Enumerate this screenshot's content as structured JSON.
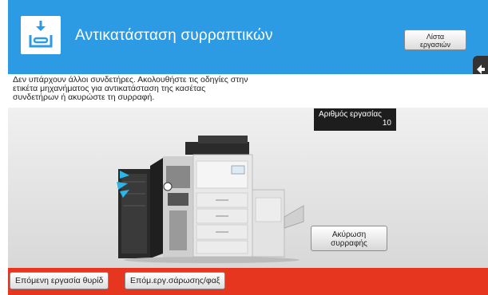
{
  "header": {
    "title": "Αντικατάσταση συρραπτικών",
    "icon": "staple-cartridge-icon",
    "job_list_line1": "Λίστα",
    "job_list_line2": "εργασιών",
    "side_tab_icon": "arrow-left-icon"
  },
  "message": {
    "line1": "Δεν υπάρχουν άλλοι συνδετήρες. Ακολουθήστε τις οδηγίες στην",
    "line2": "ετικέτα μηχανήματος για αντικατάσταση της κασέτας",
    "line3": "συνδετήρων ή ακυρώστε τη συρραφή."
  },
  "job": {
    "label": "Αριθμός εργασίας",
    "value": "10"
  },
  "cancel": {
    "line1": "Ακύρωση",
    "line2": "συρραφής"
  },
  "footer": {
    "next_job_label": "Επόμενη εργασία θυρίδ",
    "next_scan_label": "Επόμ.εργ.σάρωσης/φαξ"
  },
  "colors": {
    "header": "#2d9be3",
    "footer": "#e6361f",
    "highlight": "#29b6e8"
  }
}
